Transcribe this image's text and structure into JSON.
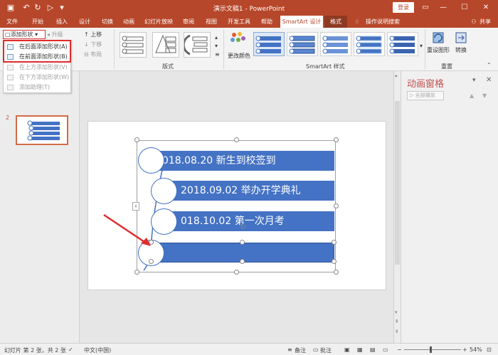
{
  "titlebar": {
    "doc_title": "演示文稿1 - PowerPoint",
    "login": "登录"
  },
  "tabs": [
    "文件",
    "开始",
    "插入",
    "设计",
    "切换",
    "动画",
    "幻灯片放映",
    "审阅",
    "视图",
    "开发工具",
    "帮助",
    "SmartArt 设计",
    "格式"
  ],
  "tellme": "操作说明搜索",
  "share": "共享",
  "ribbon": {
    "add_shape": "添加形状",
    "promote": "升级",
    "move_up": "上移",
    "move_down": "下移",
    "layout_small": "布局",
    "group_layouts": "版式",
    "change_colors": "更改颜色",
    "group_styles": "SmartArt 样式",
    "reset_graphic": "重设图形",
    "convert": "转换",
    "group_reset": "重置"
  },
  "dropdown": {
    "items": [
      {
        "label": "在后面添加形状(A)",
        "enabled": true
      },
      {
        "label": "在前面添加形状(B)",
        "enabled": true
      },
      {
        "label": "在上方添加形状(V)",
        "enabled": false
      },
      {
        "label": "在下方添加形状(W)",
        "enabled": false
      },
      {
        "label": "添加助理(T)",
        "enabled": false
      }
    ]
  },
  "thumbnail": {
    "number": "2"
  },
  "slide": {
    "items": [
      {
        "text": "2018.08.20  新生到校签到"
      },
      {
        "text": "2018.09.02   举办开学典礼"
      },
      {
        "text": "018.10.02  第一次月考"
      },
      {
        "text": ""
      }
    ]
  },
  "anim_pane": {
    "title": "动画窗格",
    "play_all": "全部播放"
  },
  "status": {
    "slide_info": "幻灯片 第 2 张，共 2 张",
    "language": "中文(中国)",
    "notes": "备注",
    "comments": "批注",
    "zoom": "54%"
  },
  "colors": {
    "brand": "#b7472a",
    "shape_fill": "#4472c4",
    "highlight": "#e02b2b"
  }
}
